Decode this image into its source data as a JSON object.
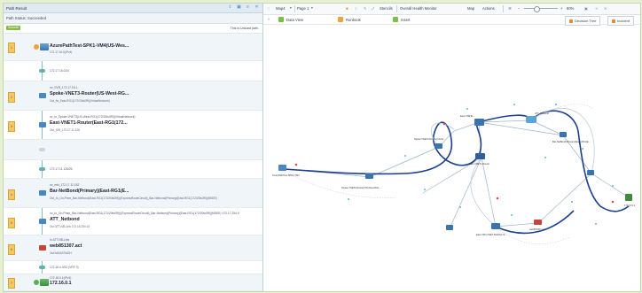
{
  "left_panel": {
    "title": "Path Result",
    "status_label": "Path Status: Succeeded",
    "success_badge": "Success",
    "unicast_note": "This is Unicast path.",
    "rows": [
      {
        "num": "1",
        "small": "",
        "main": "AzurePathTest-SPK1-VM4(US-Wes...",
        "sub": "172.17.16.6(IPv4)",
        "kind": "device"
      },
      {
        "num": "",
        "small": "172.17.16.0/24",
        "main": "",
        "sub": "",
        "kind": "iface"
      },
      {
        "num": "2",
        "small": "nv_SVR_172.17.16.1",
        "main": "Spoke-VNET3-Router(US-West-RG...",
        "sub": "Out_fw_East-RG1(172/20ts0Ri)(VirtualNetwork)",
        "kind": "device"
      },
      {
        "num": "3",
        "small": "nv_to_Spoke-VNET3(US-West-RG1(172/20ts0Ri)(VirtualNetwork)",
        "main": "East-VNET1-Router(East-RG1(172...",
        "sub": "Out_SW_172.17.11.128",
        "kind": "device"
      },
      {
        "num": "",
        "small": "",
        "main": "",
        "sub": "",
        "kind": "blank"
      },
      {
        "num": "",
        "small": "172.17.11.128/26",
        "main": "",
        "sub": "",
        "kind": "iface"
      },
      {
        "num": "4",
        "small": "nv_mkt_172.17.11.152",
        "main": "Bar-NetBond(Primary)(East-RG1(E...",
        "sub": "Out_to_On-Prem_Bar-Netbond(East-RG1(172/20ts0Ri))(ExpressRouteCircuit)_Bar-Netbond(Primary)(East-RG1(172/20ts0Ri)(MSEE)",
        "kind": "device"
      },
      {
        "num": "5",
        "small": "nv_to_On-Prem_Bar-Netbond(East-RG1(172/20ts0Ri))(ExpressRouteCircuit)_Bar-Netbond(Primary)(East-RG1(172/20ts0Ri)(MSEE) 172.17.254.9",
        "main": "ATT_Netbond",
        "sub": "Out ATT-NB-Link 172.16.254.10",
        "kind": "device"
      },
      {
        "num": "6",
        "small": "In ATT-NB-Link",
        "main": "web851307.act",
        "sub": "Out:MAGATIADH",
        "kind": "device"
      },
      {
        "num": "",
        "small": "172.16.0.0/22 (VRF 0)",
        "main": "",
        "sub": "",
        "kind": "iface"
      },
      {
        "num": "7",
        "small": "172.16.0.1(IPv4)",
        "main": "172.16.0.1",
        "sub": "",
        "kind": "end"
      }
    ]
  },
  "toolbar": {
    "map_label": "Map4",
    "page_label": "Page 1",
    "stencils": "Stencils",
    "health": "Overall Health Monitor",
    "map": "Map",
    "actions": "Actions",
    "zoom": "60%"
  },
  "tabs": [
    {
      "label": "Data View",
      "color": "#7bbf4a"
    },
    {
      "label": "Runbook",
      "color": "#f0a23b"
    },
    {
      "label": "Insert",
      "color": "#7bbf4a"
    }
  ],
  "buttons": {
    "decision_tree": "Decision Tree",
    "incident": "Incident"
  },
  "map_labels": {
    "source": "AzurePathTest-SPK1-VM4",
    "spoke": "Spoke-VNET3-Router(US-West-RG1...",
    "east1": "East-VNET1-Router(East-RG1(172...",
    "barnet": "Bar-NetBond(Primary)(East-RG1(E...",
    "east_mid": "East-VNET1-Router",
    "att": "ATT_Netbond",
    "vnet_bar": "East-VPN-VNET-RGR1(172...",
    "web": "web851307.act",
    "dest": "172.16.0.1",
    "node_a": "East-VNETa...",
    "node_b": "Spoke-VNET3-Router(US-W..."
  },
  "colors": {
    "path": "#1b3f8f",
    "link": "#9fb6cc",
    "background": "#e6f0d4"
  }
}
